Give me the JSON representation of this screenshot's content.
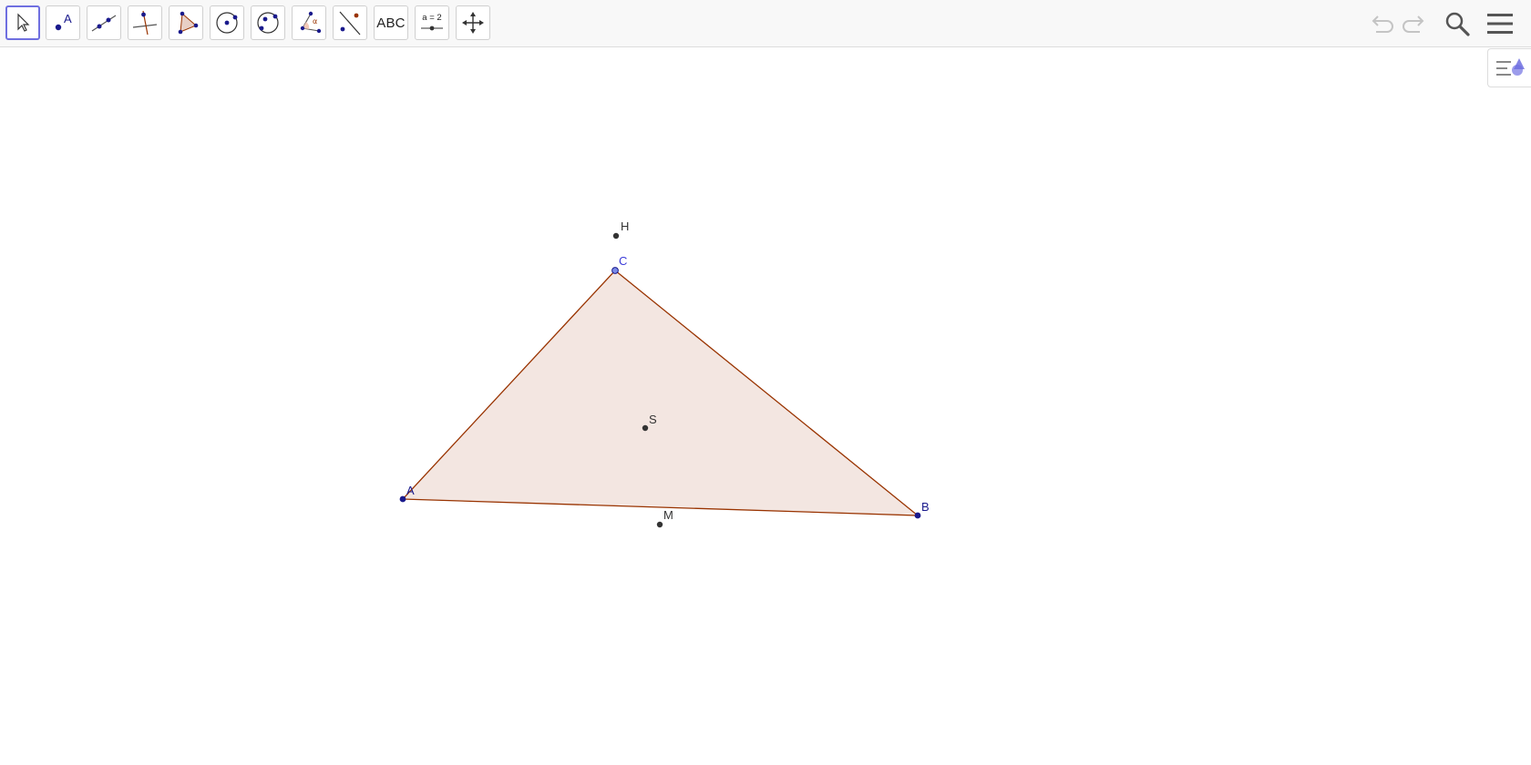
{
  "toolbar": {
    "tools": [
      {
        "name": "move-tool",
        "icon": "cursor-arrow-icon",
        "active": true
      },
      {
        "name": "point-tool",
        "icon": "point-icon",
        "label": "A"
      },
      {
        "name": "line-tool",
        "icon": "line-through-two-points-icon"
      },
      {
        "name": "perpendicular-line-tool",
        "icon": "perpendicular-line-icon"
      },
      {
        "name": "polygon-tool",
        "icon": "polygon-icon"
      },
      {
        "name": "circle-center-point-tool",
        "icon": "circle-center-point-icon"
      },
      {
        "name": "circle-three-points-tool",
        "icon": "circle-three-points-icon"
      },
      {
        "name": "angle-tool",
        "icon": "angle-icon",
        "label": "α"
      },
      {
        "name": "reflect-about-line-tool",
        "icon": "reflect-line-icon"
      },
      {
        "name": "text-tool",
        "icon": "text-icon",
        "label": "ABC"
      },
      {
        "name": "slider-tool",
        "icon": "slider-icon",
        "label": "a = 2"
      },
      {
        "name": "move-graphics-view-tool",
        "icon": "move-arrows-icon"
      }
    ],
    "right": {
      "undo_icon": "undo-icon",
      "redo_icon": "redo-icon",
      "search_icon": "search-icon",
      "menu_icon": "hamburger-menu-icon"
    }
  },
  "style_bar_icon": "style-bar-toggle-icon",
  "colors": {
    "point_free": "#1a1a8c",
    "point_dependent": "#333333",
    "polygon_fill": "#f3e6e1",
    "polygon_stroke": "#993300",
    "accent": "#6f6fe0"
  },
  "construction": {
    "points": [
      {
        "name": "A",
        "type": "free"
      },
      {
        "name": "B",
        "type": "free"
      },
      {
        "name": "C",
        "type": "free"
      },
      {
        "name": "H",
        "type": "dependent"
      },
      {
        "name": "S",
        "type": "dependent"
      },
      {
        "name": "M",
        "type": "dependent"
      }
    ],
    "polygon": [
      "A",
      "B",
      "C"
    ]
  }
}
